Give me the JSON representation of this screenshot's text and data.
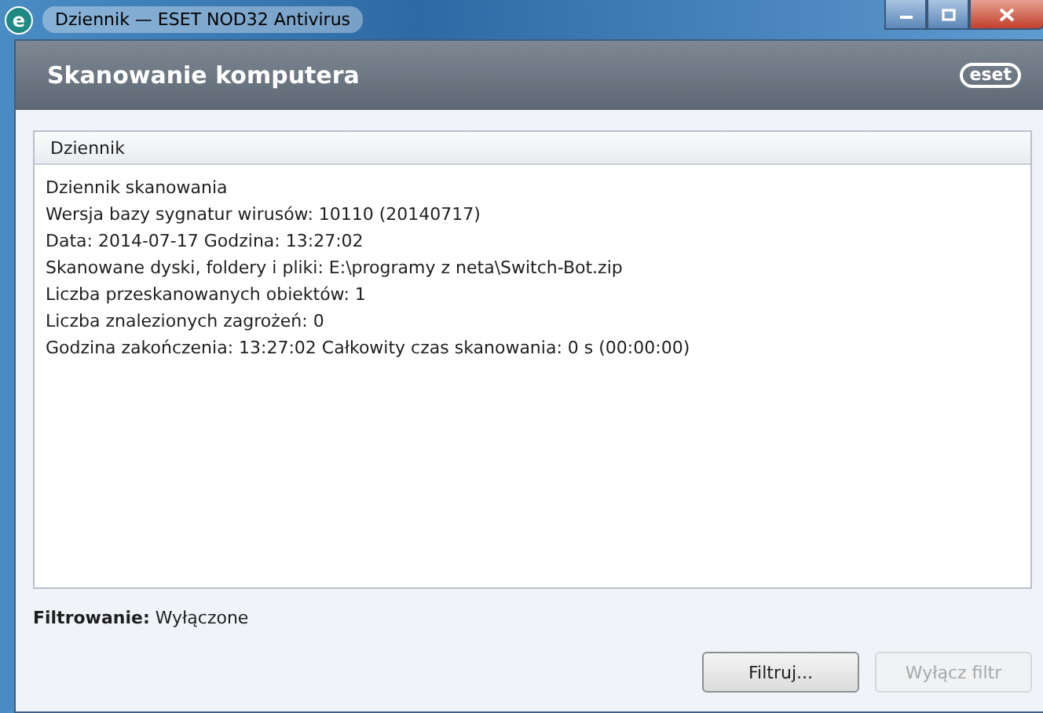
{
  "window": {
    "title": "Dziennik — ESET NOD32 Antivirus",
    "app_icon": "e"
  },
  "header": {
    "title": "Skanowanie komputera",
    "logo": "eset"
  },
  "log_panel": {
    "title": "Dziennik",
    "lines": [
      "Dziennik skanowania",
      "Wersja bazy sygnatur wirusów: 10110 (20140717)",
      "Data: 2014-07-17  Godzina: 13:27:02",
      "Skanowane dyski, foldery i pliki: E:\\programy z neta\\Switch-Bot.zip",
      "Liczba przeskanowanych obiektów: 1",
      "Liczba znalezionych zagrożeń: 0",
      "Godzina zakończenia: 13:27:02  Całkowity czas skanowania: 0 s (00:00:00)"
    ]
  },
  "filter_status": "**Filtrowanie:** Wyłączone",
  "buttons": [
    {
      "label": "Filtruj...",
      "disabled": false
    },
    {
      "label": "Wyłącz filtr",
      "disabled": true
    }
  ]
}
